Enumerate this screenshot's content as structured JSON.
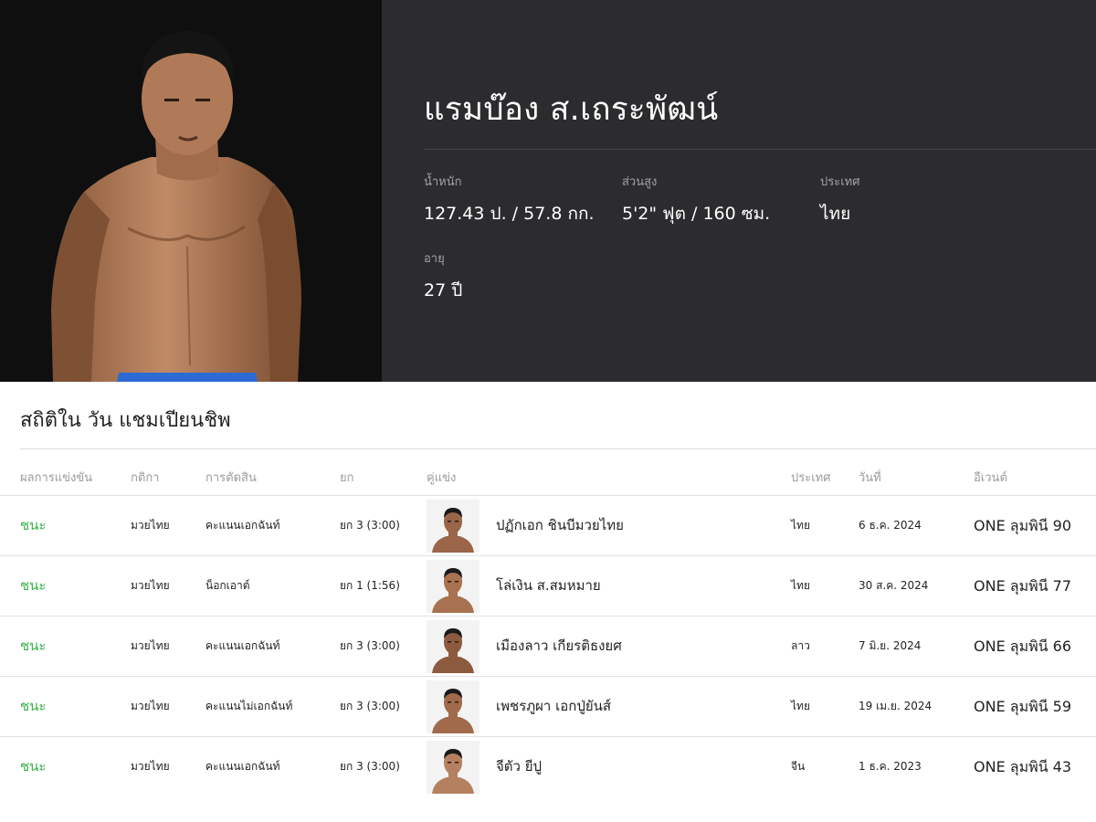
{
  "profile": {
    "name": "แรมบ๊อง ส.เถระพัฒน์",
    "stats": {
      "weight_label": "น้ำหนัก",
      "weight_value": "127.43 ป. / 57.8 กก.",
      "height_label": "ส่วนสูง",
      "height_value": "5'2\" ฟุต / 160 ซม.",
      "country_label": "ประเทศ",
      "country_value": "ไทย",
      "age_label": "อายุ",
      "age_value": "27 ปี"
    }
  },
  "record": {
    "title": "สถิติใน วัน แชมเปียนชิพ",
    "columns": [
      "ผลการแข่งขัน",
      "กติกา",
      "การตัดสิน",
      "ยก",
      "คู่แข่ง",
      "ประเทศ",
      "วันที่",
      "อีเวนต์"
    ],
    "rows": [
      {
        "result": "ชนะ",
        "sport": "มวยไทย",
        "method": "คะแนนเอกฉันท์",
        "round": "ยก 3 (3:00)",
        "opponent": "ปฏักเอก ชินบีมวยไทย",
        "country": "ไทย",
        "date": "6 ธ.ค. 2024",
        "event": "ONE ลุมพินี 90"
      },
      {
        "result": "ชนะ",
        "sport": "มวยไทย",
        "method": "น็อกเอาต์",
        "round": "ยก 1 (1:56)",
        "opponent": "โล่เงิน ส.สมหมาย",
        "country": "ไทย",
        "date": "30 ส.ค. 2024",
        "event": "ONE ลุมพินี 77"
      },
      {
        "result": "ชนะ",
        "sport": "มวยไทย",
        "method": "คะแนนเอกฉันท์",
        "round": "ยก 3 (3:00)",
        "opponent": "เมืองลาว เกียรติธงยศ",
        "country": "ลาว",
        "date": "7 มิ.ย. 2024",
        "event": "ONE ลุมพินี 66"
      },
      {
        "result": "ชนะ",
        "sport": "มวยไทย",
        "method": "คะแนนไม่เอกฉันท์",
        "round": "ยก 3 (3:00)",
        "opponent": "เพชรภูผา เอกปู่ยันส์",
        "country": "ไทย",
        "date": "19 เม.ย. 2024",
        "event": "ONE ลุมพินี 59"
      },
      {
        "result": "ชนะ",
        "sport": "มวยไทย",
        "method": "คะแนนเอกฉันท์",
        "round": "ยก 3 (3:00)",
        "opponent": "จีตัว ยีปู",
        "country": "จีน",
        "date": "1 ธ.ค. 2023",
        "event": "ONE ลุมพินี 43"
      }
    ]
  },
  "colors": {
    "hero_bg": "#2c2c2f",
    "photo_bg": "#0f0f10",
    "win_green": "#37b24a"
  }
}
